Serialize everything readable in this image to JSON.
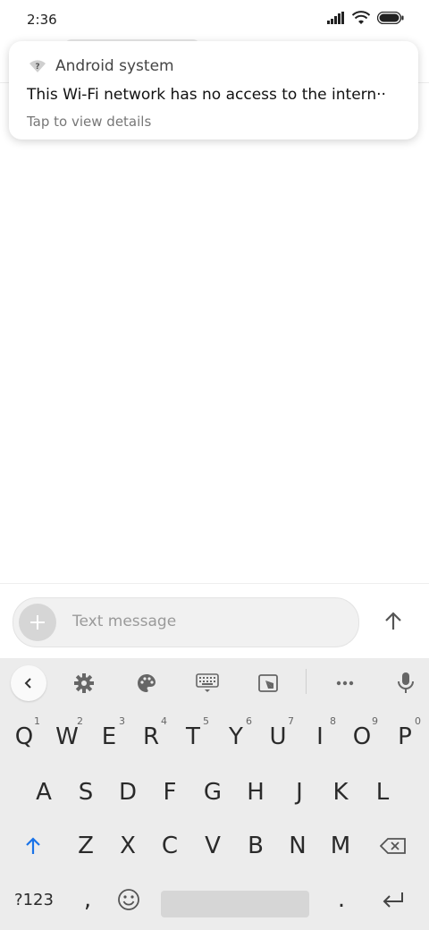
{
  "status_bar": {
    "time": "2:36",
    "icons": [
      "signal-icon",
      "wifi-icon",
      "battery-icon"
    ]
  },
  "notification": {
    "app_icon": "wifi-question-icon",
    "app_name": "Android system",
    "title": "This Wi-Fi network has no access to the intern··",
    "detail": "Tap to view details"
  },
  "compose": {
    "placeholder": "Text message",
    "add_icon": "plus-icon",
    "send_icon": "arrow-up-icon"
  },
  "keyboard": {
    "toolbar": [
      "chevron-left-icon",
      "gear-icon",
      "palette-icon",
      "keyboard-icon",
      "resize-icon",
      "more-icon",
      "mic-icon"
    ],
    "row1": [
      {
        "label": "Q",
        "hint": "1"
      },
      {
        "label": "W",
        "hint": "2"
      },
      {
        "label": "E",
        "hint": "3"
      },
      {
        "label": "R",
        "hint": "4"
      },
      {
        "label": "T",
        "hint": "5"
      },
      {
        "label": "Y",
        "hint": "6"
      },
      {
        "label": "U",
        "hint": "7"
      },
      {
        "label": "I",
        "hint": "8"
      },
      {
        "label": "O",
        "hint": "9"
      },
      {
        "label": "P",
        "hint": "0"
      }
    ],
    "row2": [
      "A",
      "S",
      "D",
      "F",
      "G",
      "H",
      "J",
      "K",
      "L"
    ],
    "row3": [
      "Z",
      "X",
      "C",
      "V",
      "B",
      "N",
      "M"
    ],
    "symbols_label": "?123",
    "comma_label": ",",
    "period_label": ".",
    "accent_color": "#1a73e8"
  }
}
